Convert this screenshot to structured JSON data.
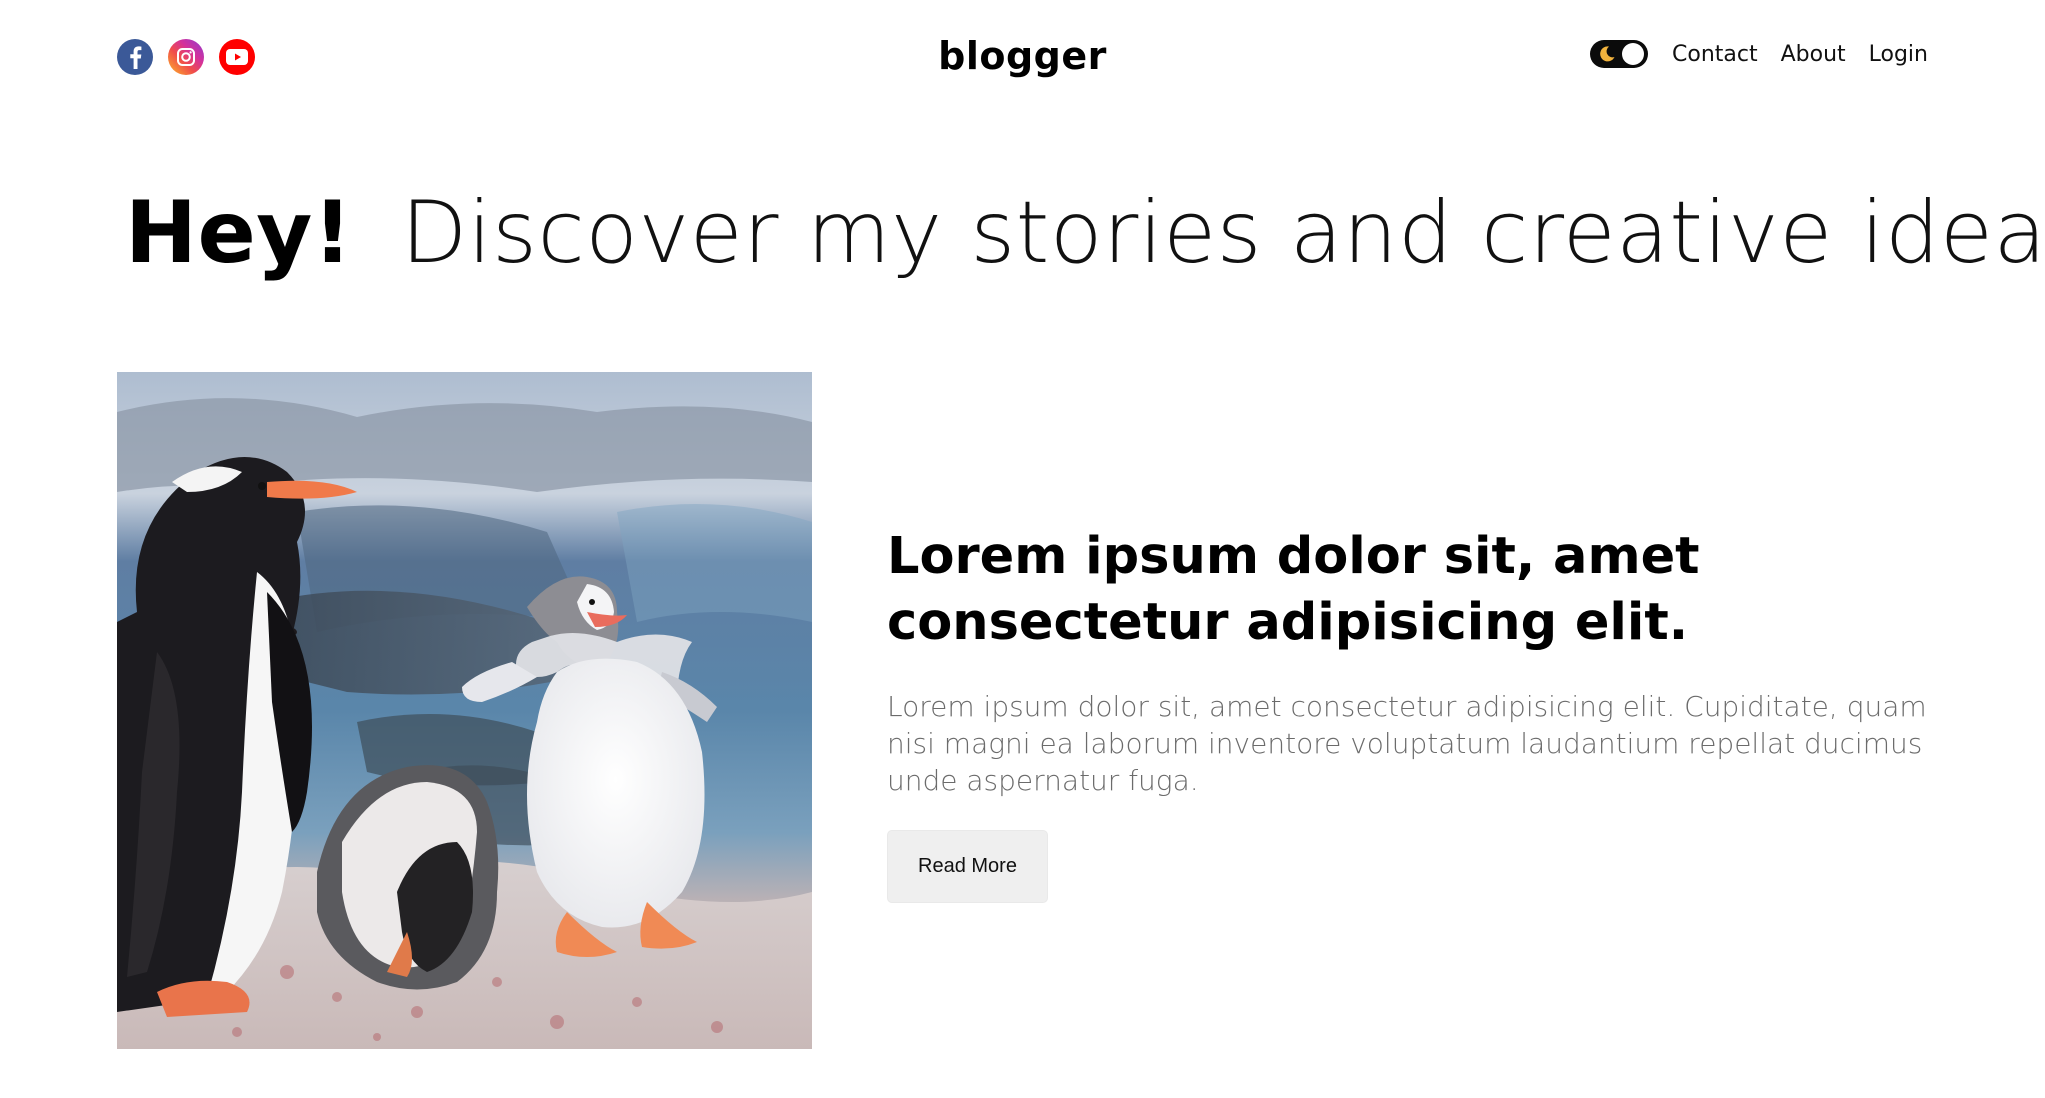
{
  "navbar": {
    "social_icons": [
      "facebook-icon",
      "instagram-icon",
      "youtube-icon"
    ],
    "logo": "blogger",
    "theme_toggle_icon": "moon-icon",
    "links": [
      {
        "label": "Contact"
      },
      {
        "label": "About"
      },
      {
        "label": "Login"
      }
    ]
  },
  "hero": {
    "bold": "Hey!",
    "light": "Discover my stories and creative ideas."
  },
  "featured_post": {
    "image": "penguins",
    "title": "Lorem ipsum dolor sit, amet consectetur adipisicing elit.",
    "description": "Lorem ipsum dolor sit, amet consectetur adipisicing elit. Cupiditate, quam nisi magni ea laborum inventore voluptatum laudantium repellat ducimus unde aspernatur fuga.",
    "button_label": "Read More"
  },
  "colors": {
    "facebook": "#3b5998",
    "youtube": "#ff0000",
    "toggle": "#0b0b0b",
    "moon": "#f2b33d",
    "button_bg": "#efefef",
    "desc_text": "#6b6b6b"
  }
}
